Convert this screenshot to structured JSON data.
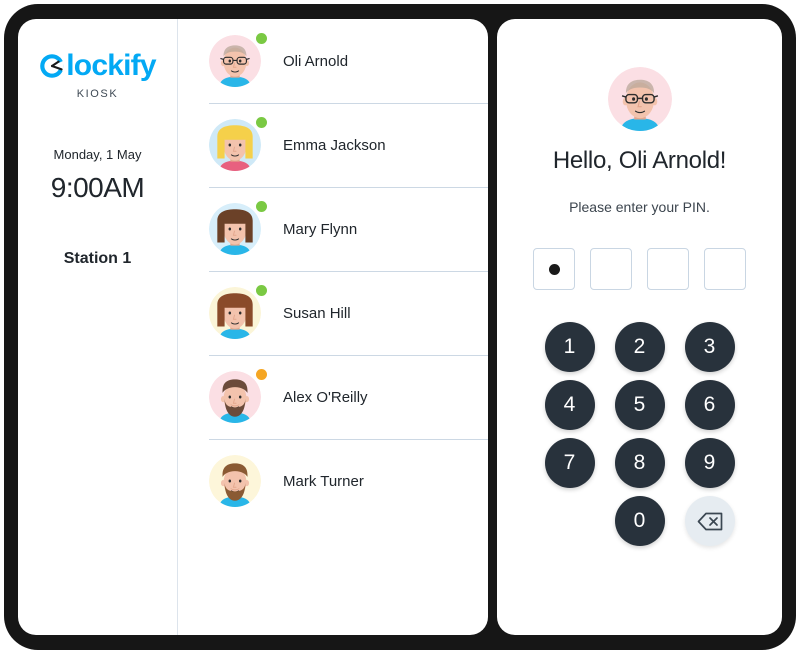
{
  "brand": {
    "logo_text": "lockify",
    "logo_initial": "C",
    "sub_label": "KIOSK",
    "accent_color": "#03a9f4",
    "clock_icon": "clock-icon"
  },
  "sidebar": {
    "date": "Monday, 1 May",
    "time": "9:00AM",
    "station": "Station 1"
  },
  "users": [
    {
      "name": "Oli Arnold",
      "status": "online",
      "status_color": "#7ac943",
      "avatar_bg": "#fbdfe4",
      "hair": "#b9a79a",
      "hair_style": "bald",
      "glasses": true,
      "beard": false,
      "shirt": "#29b6e8"
    },
    {
      "name": "Emma Jackson",
      "status": "online",
      "status_color": "#7ac943",
      "avatar_bg": "#cfe9f7",
      "hair": "#f5d04a",
      "hair_style": "long",
      "glasses": false,
      "beard": false,
      "shirt": "#e8607f"
    },
    {
      "name": "Mary Flynn",
      "status": "online",
      "status_color": "#7ac943",
      "avatar_bg": "#d7eefa",
      "hair": "#6b4128",
      "hair_style": "long",
      "glasses": false,
      "beard": false,
      "shirt": "#29b6e8"
    },
    {
      "name": "Susan Hill",
      "status": "online",
      "status_color": "#7ac943",
      "avatar_bg": "#fbf5d8",
      "hair": "#8a4b2a",
      "hair_style": "long",
      "glasses": false,
      "beard": false,
      "shirt": "#29b6e8"
    },
    {
      "name": "Alex O'Reilly",
      "status": "away",
      "status_color": "#f5a623",
      "avatar_bg": "#fbdfe4",
      "hair": "#6b4b3a",
      "hair_style": "short",
      "glasses": false,
      "beard": true,
      "shirt": "#29b6e8"
    },
    {
      "name": "Mark Turner",
      "status": "none",
      "status_color": "",
      "avatar_bg": "#fdf6da",
      "hair": "#8a5a33",
      "hair_style": "short",
      "glasses": false,
      "beard": true,
      "shirt": "#29b6e8"
    }
  ],
  "pin_panel": {
    "greeting": "Hello, Oli Arnold!",
    "prompt": "Please enter your PIN.",
    "avatar_bg": "#fbdfe4",
    "pin_length": 4,
    "pin_filled": 1,
    "keys": [
      "1",
      "2",
      "3",
      "4",
      "5",
      "6",
      "7",
      "8",
      "9",
      "",
      "0",
      "backspace-icon"
    ],
    "key_color": "#28323c",
    "backspace_color": "#e6ecf1"
  }
}
